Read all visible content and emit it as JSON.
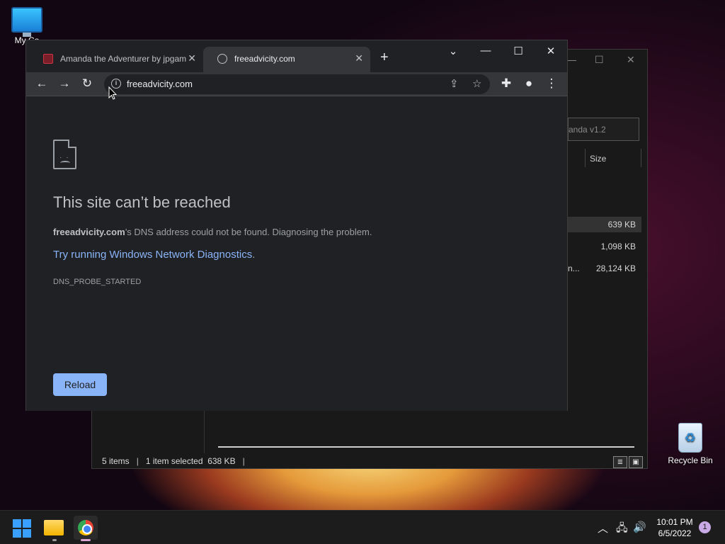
{
  "desktop": {
    "icons": [
      {
        "label": "My Co"
      },
      {
        "label": "Recycle Bin"
      }
    ]
  },
  "explorer": {
    "search_placeholder": "anda v1.2",
    "size_header": "Size",
    "rows": [
      {
        "prefix": "",
        "size": "639 KB"
      },
      {
        "prefix": "",
        "size": "1,098 KB"
      },
      {
        "prefix": "n...",
        "size": "28,124 KB"
      }
    ],
    "status": {
      "items": "5 items",
      "selected": "1 item selected",
      "selected_size": "638 KB"
    }
  },
  "chrome": {
    "tabs": [
      {
        "title": "Amanda the Adventurer by jpgam",
        "active": false
      },
      {
        "title": "freeadvicity.com",
        "active": true
      }
    ],
    "omnibox_url": "freeadvicity.com",
    "error": {
      "title": "This site can’t be reached",
      "host": "freeadvicity.com",
      "desc": "’s DNS address could not be found. Diagnosing the problem.",
      "link": "Try running Windows Network Diagnostics",
      "link_tail": ".",
      "code": "DNS_PROBE_STARTED",
      "reload_label": "Reload"
    }
  },
  "taskbar": {
    "time": "10:01 PM",
    "date": "6/5/2022",
    "notification_count": "1"
  },
  "colors": {
    "link": "#8ab4f8",
    "reload_bg": "#8ab4f8",
    "chrome_bg": "#202124",
    "toolbar_bg": "#35363a"
  }
}
